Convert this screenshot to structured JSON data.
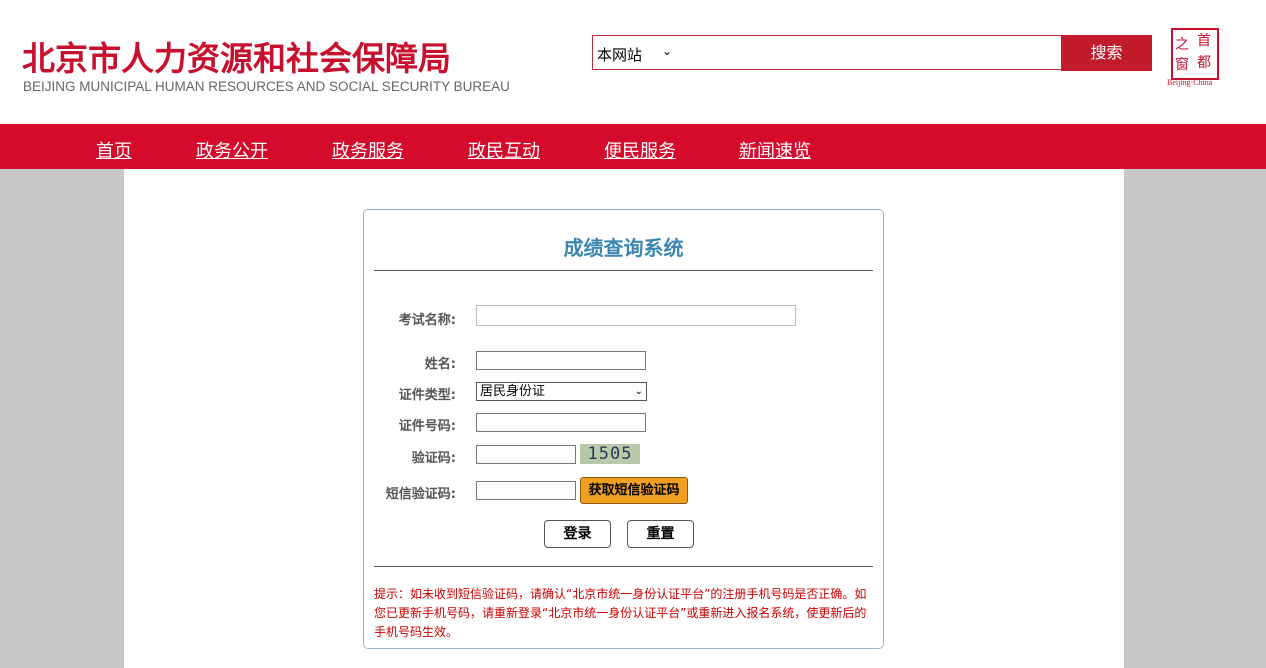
{
  "header": {
    "title_cn": "北京市人力资源和社会保障局",
    "title_en": "BEIJING MUNICIPAL HUMAN RESOURCES AND SOCIAL SECURITY BUREAU",
    "search_scope": "本网站",
    "search_value": "",
    "search_button": "搜索",
    "logo_chars": [
      "首",
      "都",
      "之",
      "窗"
    ],
    "logo_caption": "Beijing·China"
  },
  "nav": {
    "items": [
      {
        "label": "首页"
      },
      {
        "label": "政务公开"
      },
      {
        "label": "政务服务"
      },
      {
        "label": "政民互动"
      },
      {
        "label": "便民服务"
      },
      {
        "label": "新闻速览"
      }
    ]
  },
  "form": {
    "title": "成绩查询系统",
    "exam_name_label": "考试名称:",
    "exam_name_value": "",
    "name_label": "姓名:",
    "name_value": "",
    "id_type_label": "证件类型:",
    "id_type_selected": "居民身份证",
    "id_number_label": "证件号码:",
    "id_number_value": "",
    "captcha_label": "验证码:",
    "captcha_value": "",
    "captcha_image_text": "1505",
    "sms_label": "短信验证码:",
    "sms_value": "",
    "sms_button": "获取短信验证码",
    "login_button": "登录",
    "reset_button": "重置",
    "tip": "提示：如未收到短信验证码，请确认“北京市统一身份认证平台”的注册手机号码是否正确。如您已更新手机号码，请重新登录“北京市统一身份认证平台”或重新进入报名系统，使更新后的手机号码生效。"
  },
  "colors": {
    "brand_red": "#d50b2c",
    "title_blue": "#3a86b0",
    "sms_button": "#f0a01e"
  }
}
